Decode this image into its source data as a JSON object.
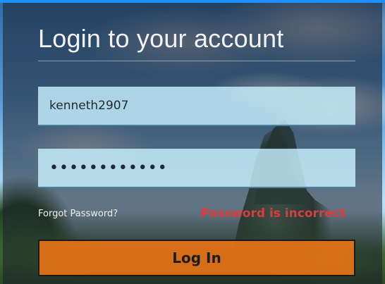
{
  "login_form": {
    "title": "Login to your account",
    "username": {
      "value": "kenneth2907"
    },
    "password": {
      "masked_value": "••••••••••••"
    },
    "forgot_password_label": "Forgot Password?",
    "error_message": "Password is incorrect",
    "submit_label": "Log In"
  },
  "colors": {
    "panel_overlay": "#191e28",
    "input_background": "#c8f0ff",
    "error_text": "#e03a3a",
    "button_background": "#f57814",
    "title_text": "#f2f2f2"
  }
}
